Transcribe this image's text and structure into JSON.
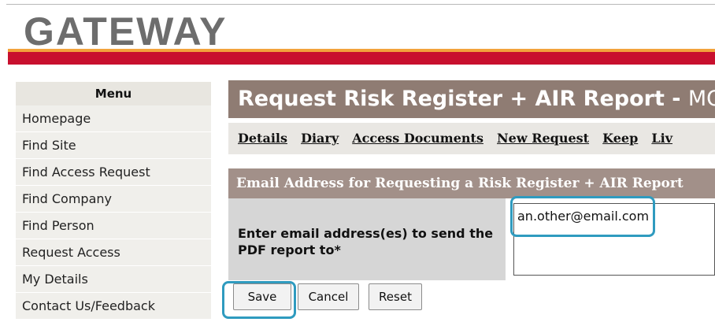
{
  "logo": "GATEWAY",
  "menu": {
    "header": "Menu",
    "items": [
      "Homepage",
      "Find Site",
      "Find Access Request",
      "Find Company",
      "Find Person",
      "Request Access",
      "My Details",
      "Contact Us/Feedback"
    ]
  },
  "page": {
    "title": "Request Risk Register + AIR Report - ",
    "title_suffix": "MON",
    "tabs": [
      "Details",
      "Diary",
      "Access Documents",
      "New Request",
      "Keep",
      "Liv"
    ]
  },
  "form": {
    "section_title": "Email Address for Requesting a Risk Register + AIR Report",
    "email_label": "Enter email address(es) to send the PDF report to*",
    "email_value": "an.other@email.com"
  },
  "buttons": {
    "save": "Save",
    "cancel": "Cancel",
    "reset": "Reset"
  },
  "colors": {
    "brand_red": "#c8102e",
    "brand_orange": "#f2a33c",
    "title_bar": "#8f7c73",
    "highlight": "#2f9bbf"
  }
}
